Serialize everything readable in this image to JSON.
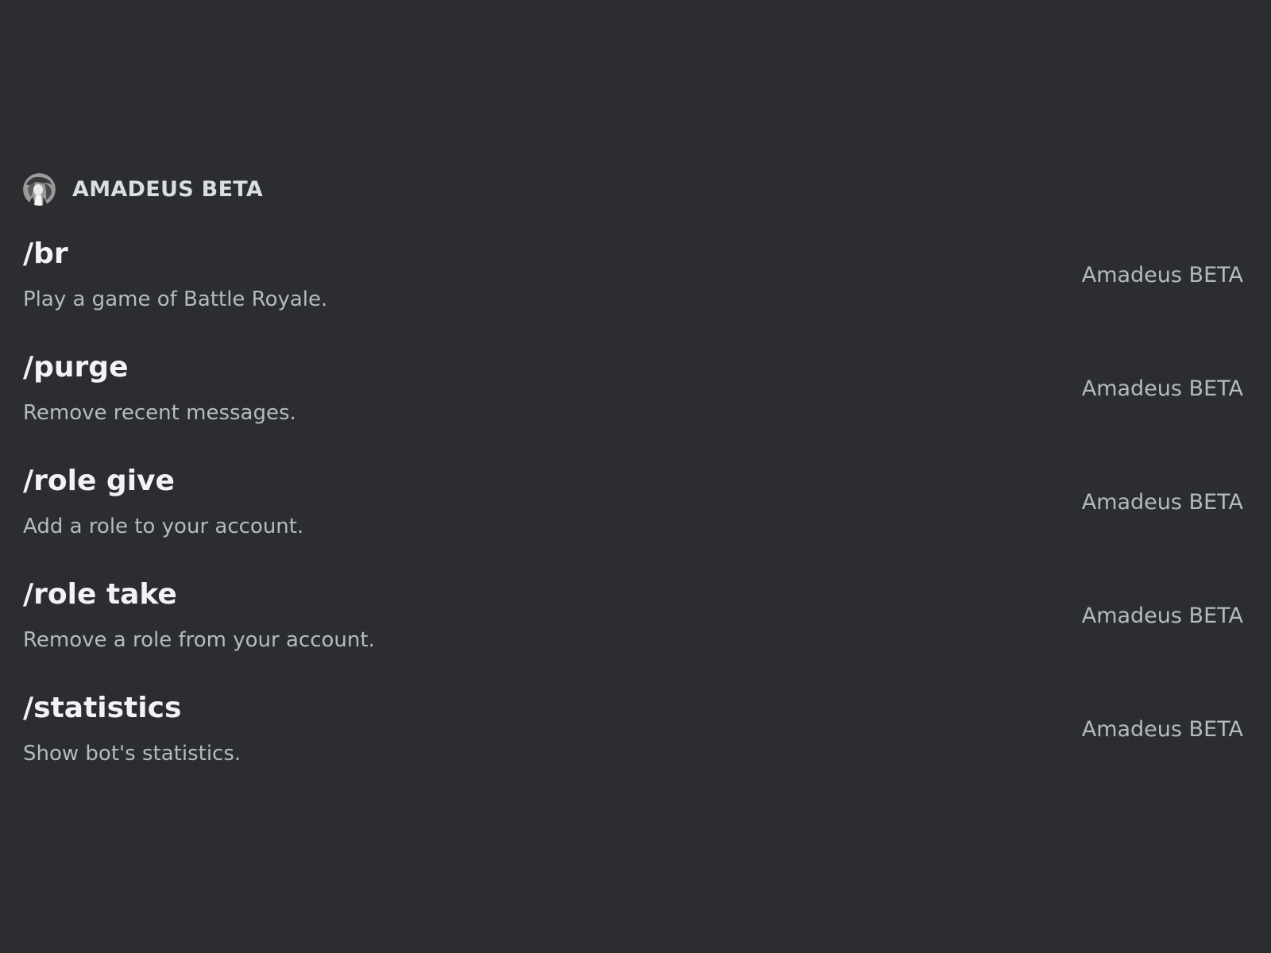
{
  "section": {
    "title": "AMADEUS BETA",
    "avatar_icon": "bot-avatar"
  },
  "commands": [
    {
      "name": "/br",
      "description": "Play a game of Battle Royale.",
      "source": "Amadeus BETA"
    },
    {
      "name": "/purge",
      "description": "Remove recent messages.",
      "source": "Amadeus BETA"
    },
    {
      "name": "/role give",
      "description": "Add a role to your account.",
      "source": "Amadeus BETA"
    },
    {
      "name": "/role take",
      "description": "Remove a role from your account.",
      "source": "Amadeus BETA"
    },
    {
      "name": "/statistics",
      "description": "Show bot's statistics.",
      "source": "Amadeus BETA"
    }
  ],
  "colors": {
    "background": "#2b2d31",
    "command_name": "#f2f3f5",
    "secondary_text": "#b5bac1"
  }
}
